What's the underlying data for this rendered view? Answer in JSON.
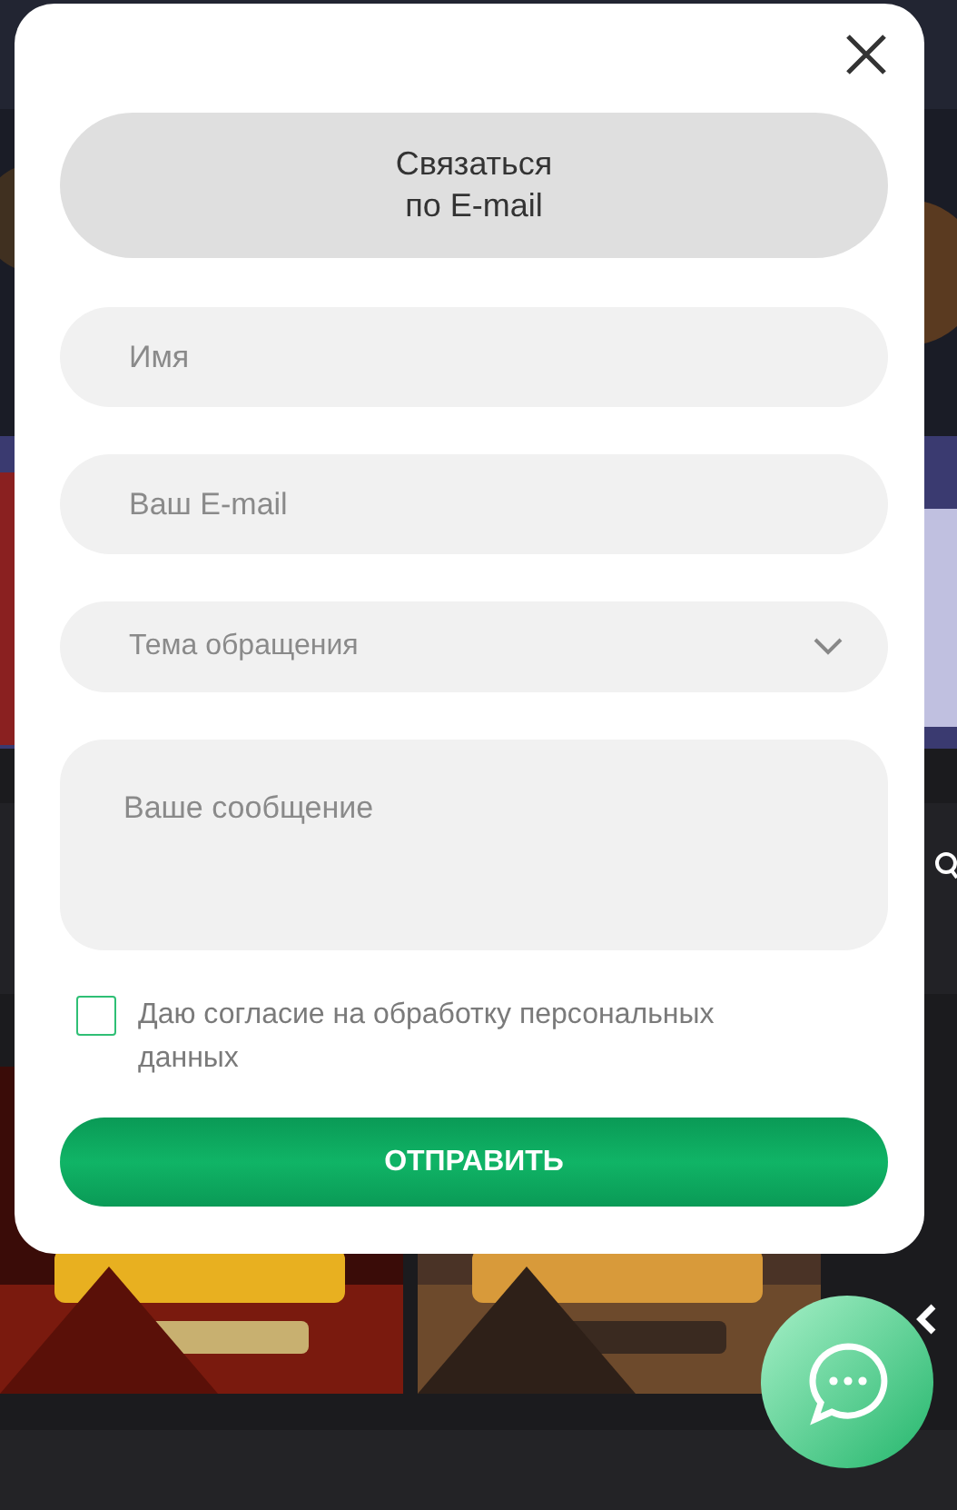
{
  "dialog": {
    "contact_button": {
      "label": "Связаться\nпо E-mail"
    },
    "fields": [
      {
        "kind": "input",
        "placeholder": "Имя"
      },
      {
        "kind": "input",
        "placeholder": "Ваш E-mail"
      },
      {
        "kind": "select",
        "placeholder": "Тема обращения"
      },
      {
        "kind": "textarea",
        "placeholder": "Ваше сообщение"
      }
    ],
    "consent": {
      "label": "Даю согласие на обработку персональных данных",
      "checked": false
    },
    "submit": {
      "label": "ОТПРАВИТЬ"
    }
  }
}
